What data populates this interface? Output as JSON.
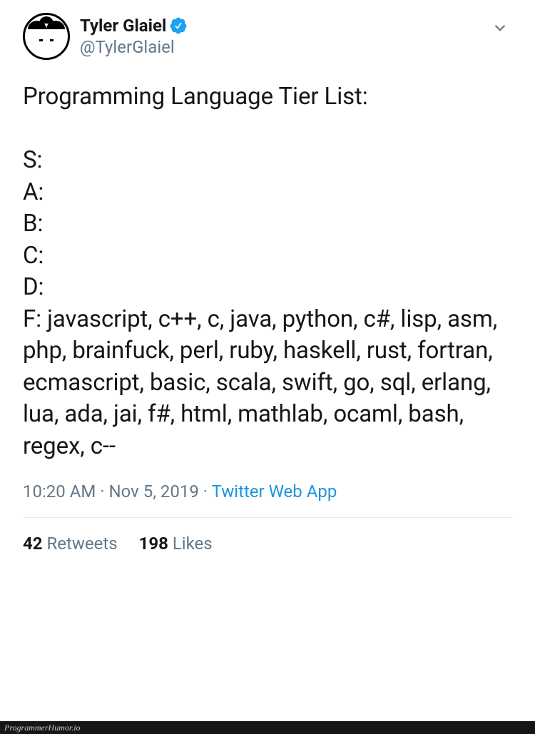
{
  "tweet": {
    "author": {
      "display_name": "Tyler Glaiel",
      "handle": "@TylerGlaiel",
      "verified": true
    },
    "text": "Programming Language Tier List:\n\nS:\nA:\nB:\nC:\nD:\nF: javascript, c++, c, java, python, c#, lisp, asm, php, brainfuck, perl, ruby, haskell, rust, fortran, ecmascript, basic, scala, swift, go, sql, erlang, lua, ada, jai, f#, html, mathlab, ocaml, bash, regex, c--",
    "timestamp": "10:20 AM · Nov 5, 2019",
    "source": "Twitter Web App",
    "stats": {
      "retweets_count": "42",
      "retweets_label": "Retweets",
      "likes_count": "198",
      "likes_label": "Likes"
    }
  },
  "watermark": "ProgrammerHumor.io"
}
